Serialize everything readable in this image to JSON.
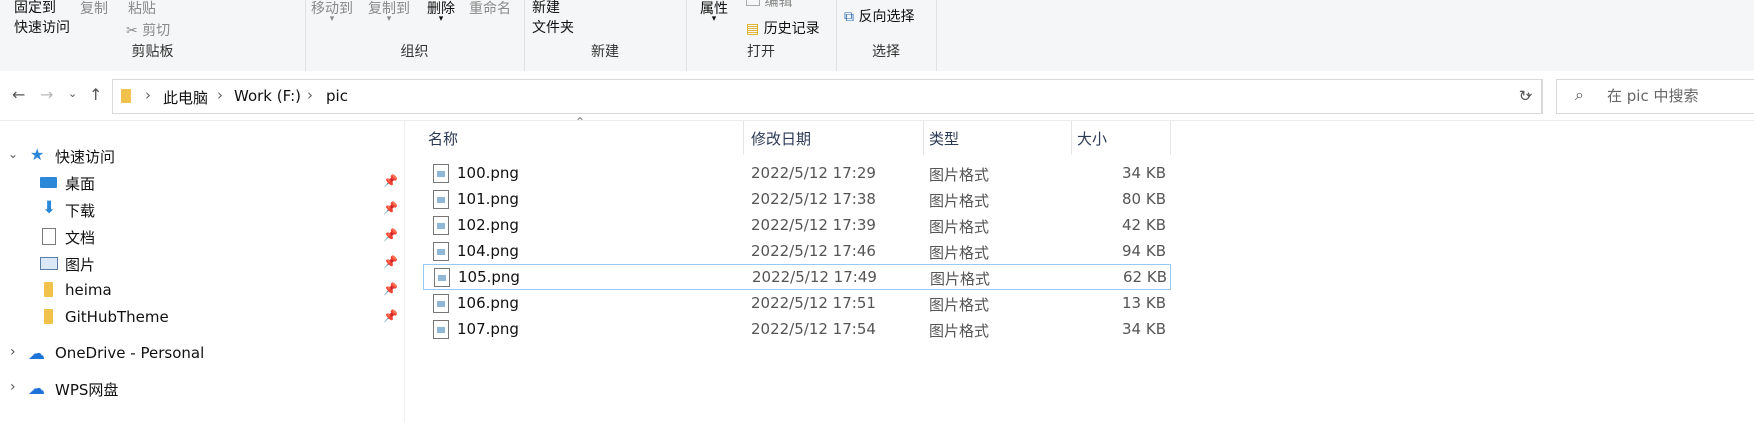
{
  "ribbon": {
    "clipboard": {
      "pin_line1": "固定到",
      "pin_line2": "快速访问",
      "copy": "复制",
      "paste": "粘贴",
      "cut": "剪切",
      "label": "剪贴板"
    },
    "organize": {
      "move_to": "移动到",
      "copy_to": "复制到",
      "delete": "删除",
      "rename": "重命名",
      "label": "组织"
    },
    "new": {
      "new_folder_line1": "新建",
      "new_folder_line2": "文件夹",
      "label": "新建"
    },
    "open": {
      "properties": "属性",
      "edit": "编辑",
      "history": "历史记录",
      "label": "打开"
    },
    "select": {
      "invert": "反向选择",
      "label": "选择"
    }
  },
  "address": {
    "crumbs": [
      "此电脑",
      "Work (F:)",
      "pic"
    ]
  },
  "search": {
    "placeholder": "在 pic 中搜索"
  },
  "nav": {
    "quick_access": "快速访问",
    "items": [
      {
        "label": "桌面",
        "icon": "desktop-icon"
      },
      {
        "label": "下载",
        "icon": "download-icon"
      },
      {
        "label": "文档",
        "icon": "document-icon"
      },
      {
        "label": "图片",
        "icon": "picture-icon"
      },
      {
        "label": "heima",
        "icon": "folder-icon"
      },
      {
        "label": "GitHubTheme",
        "icon": "folder-icon"
      }
    ],
    "onedrive": "OneDrive - Personal",
    "wps": "WPS网盘"
  },
  "columns": {
    "name": "名称",
    "date": "修改日期",
    "type": "类型",
    "size": "大小"
  },
  "files": [
    {
      "name": "100.png",
      "date": "2022/5/12 17:29",
      "type": "图片格式",
      "size": "34 KB"
    },
    {
      "name": "101.png",
      "date": "2022/5/12 17:38",
      "type": "图片格式",
      "size": "80 KB"
    },
    {
      "name": "102.png",
      "date": "2022/5/12 17:39",
      "type": "图片格式",
      "size": "42 KB"
    },
    {
      "name": "104.png",
      "date": "2022/5/12 17:46",
      "type": "图片格式",
      "size": "94 KB"
    },
    {
      "name": "105.png",
      "date": "2022/5/12 17:49",
      "type": "图片格式",
      "size": "62 KB"
    },
    {
      "name": "106.png",
      "date": "2022/5/12 17:51",
      "type": "图片格式",
      "size": "13 KB"
    },
    {
      "name": "107.png",
      "date": "2022/5/12 17:54",
      "type": "图片格式",
      "size": "34 KB"
    }
  ],
  "colors": {
    "accent": "#0078d4",
    "selection_border": "#99c9ef",
    "folder": "#f1c24b"
  }
}
